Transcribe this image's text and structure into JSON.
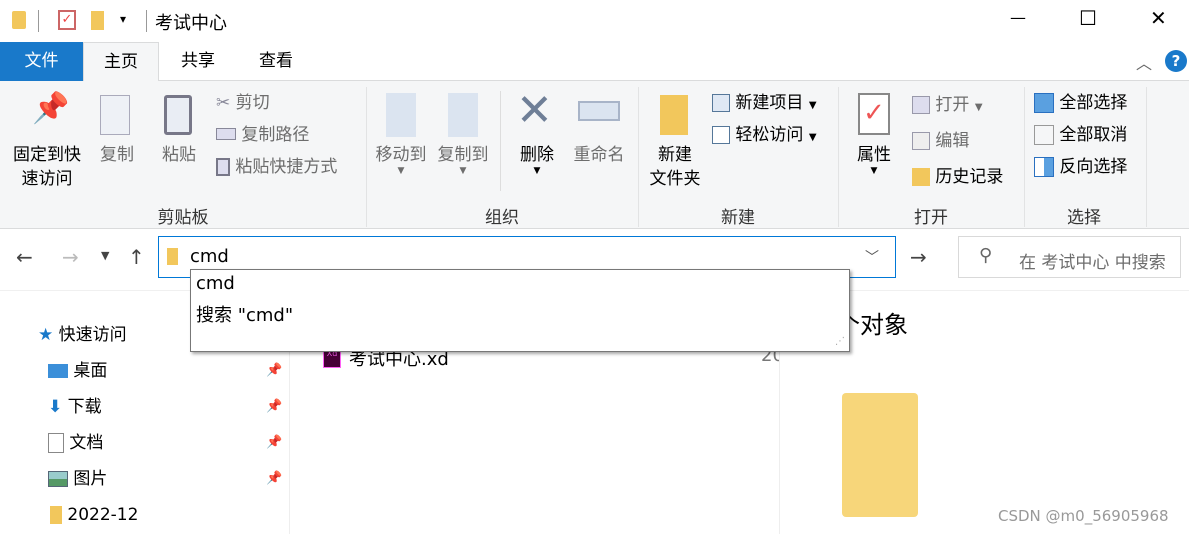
{
  "window": {
    "title": "考试中心",
    "minimize": "—",
    "maximize": "☐",
    "close": "✕"
  },
  "tabs": [
    {
      "label": "文件",
      "active": false,
      "color": "#1979ca"
    },
    {
      "label": "主页",
      "active": true
    },
    {
      "label": "共享"
    },
    {
      "label": "查看"
    }
  ],
  "help": "?",
  "ribbon": {
    "clipboard": {
      "label": "剪贴板",
      "pin": "固定到快速访问",
      "pin1": "固定到快",
      "pin2": "速访问",
      "copy": "复制",
      "paste": "粘贴",
      "cut": "剪切",
      "copy_path": "复制路径",
      "paste_shortcut": "粘贴快捷方式"
    },
    "organize": {
      "label": "组织",
      "move_to": "移动到",
      "copy_to": "复制到",
      "delete": "删除",
      "rename": "重命名"
    },
    "new": {
      "label": "新建",
      "new_folder1": "新建",
      "new_folder2": "文件夹",
      "new_item": "新建项目",
      "easy_access": "轻松访问"
    },
    "open": {
      "label": "打开",
      "properties": "属性",
      "open": "打开",
      "edit": "编辑",
      "history": "历史记录"
    },
    "select": {
      "label": "选择",
      "select_all": "全部选择",
      "select_none": "全部取消",
      "invert": "反向选择"
    }
  },
  "address": {
    "value": "cmd",
    "suggestions": [
      "cmd",
      "搜索 \"cmd\""
    ]
  },
  "search": {
    "placeholder": "在 考试中心 中搜索"
  },
  "nav_pane": [
    {
      "label": "快速访问",
      "icon": "star-icon"
    },
    {
      "label": "桌面",
      "pinned": true
    },
    {
      "label": "下载",
      "pinned": true
    },
    {
      "label": "文档",
      "pinned": true
    },
    {
      "label": "图片",
      "pinned": true
    },
    {
      "label": "2022-12"
    }
  ],
  "files": [
    {
      "name": "考试中心.xd",
      "date": "20"
    }
  ],
  "preview": {
    "text": "个对象"
  },
  "watermark": "CSDN @m0_56905968"
}
